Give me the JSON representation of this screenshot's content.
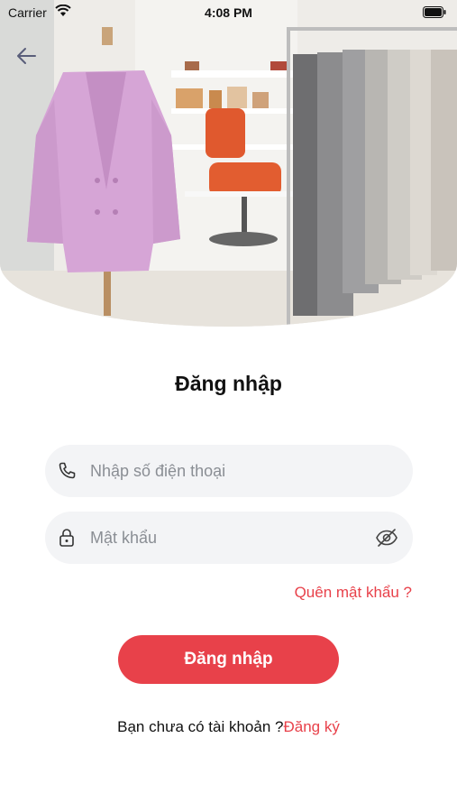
{
  "status_bar": {
    "carrier": "Carrier",
    "time": "4:08 PM"
  },
  "hero": {
    "icon": "back-arrow-icon"
  },
  "login": {
    "title": "Đăng nhập",
    "phone_placeholder": "Nhập số điện thoại",
    "password_placeholder": "Mật khẩu",
    "forgot_password": "Quên mật khẩu ?",
    "submit_label": "Đăng nhập",
    "no_account_text": "Bạn chưa có tài khoản ?",
    "register_link": "Đăng ký"
  },
  "colors": {
    "accent": "#e8414a",
    "field_background": "#f3f4f6",
    "placeholder": "#8a8e94"
  }
}
